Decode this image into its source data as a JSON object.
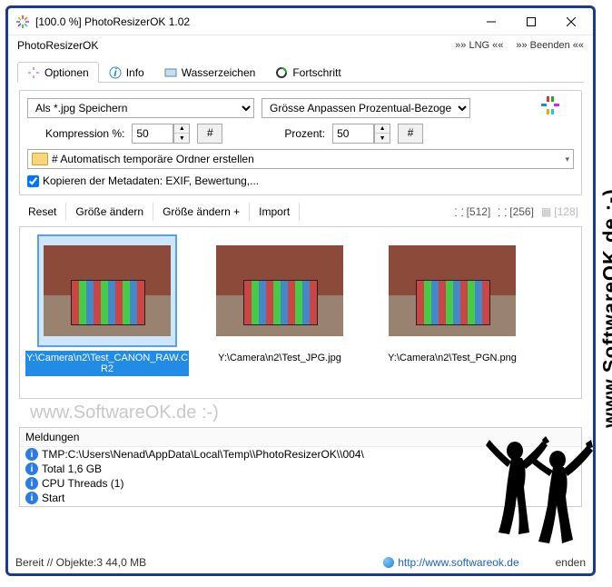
{
  "window": {
    "title": "[100.0 %] PhotoResizerOK 1.02",
    "app_name": "PhotoResizerOK"
  },
  "menubar": {
    "lng": "»» LNG ««",
    "beenden": "»» Beenden ««"
  },
  "tabs": {
    "optionen": "Optionen",
    "info": "Info",
    "wasserzeichen": "Wasserzeichen",
    "fortschritt": "Fortschritt"
  },
  "options": {
    "save_as": "Als *.jpg Speichern",
    "resize_mode": "Grösse Anpassen Prozentual-Bezoge",
    "kompression_label": "Kompression %:",
    "kompression_value": "50",
    "hash": "#",
    "prozent_label": "Prozent:",
    "prozent_value": "50",
    "folder_text": "# Automatisch temporäre Ordner erstellen",
    "copy_meta": "Kopieren der Metadaten: EXIF, Bewertung,..."
  },
  "toolbar": {
    "reset": "Reset",
    "resize": "Größe ändern",
    "resize_plus": "Größe ändern +",
    "import": "Import",
    "s512": "[512]",
    "s256": "[256]",
    "s128": "[128]"
  },
  "thumbs": [
    {
      "label": "Y:\\Camera\\n2\\Test_CANON_RAW.CR2"
    },
    {
      "label": "Y:\\Camera\\n2\\Test_JPG.jpg"
    },
    {
      "label": "Y:\\Camera\\n2\\Test_PGN.png"
    }
  ],
  "watermark": "www.SoftwareOK.de :-)",
  "messages": {
    "title": "Meldungen",
    "lines": [
      "TMP:C:\\Users\\Nenad\\AppData\\Local\\Temp\\\\PhotoResizerOK\\\\004\\",
      "Total 1,6 GB",
      "CPU Threads (1)",
      "Start"
    ]
  },
  "status": {
    "left": "Bereit // Objekte:3 44,0 MB",
    "url": "http://www.softwareok.de",
    "right": "enden"
  },
  "side": "www.SoftwareOK.de :-)"
}
